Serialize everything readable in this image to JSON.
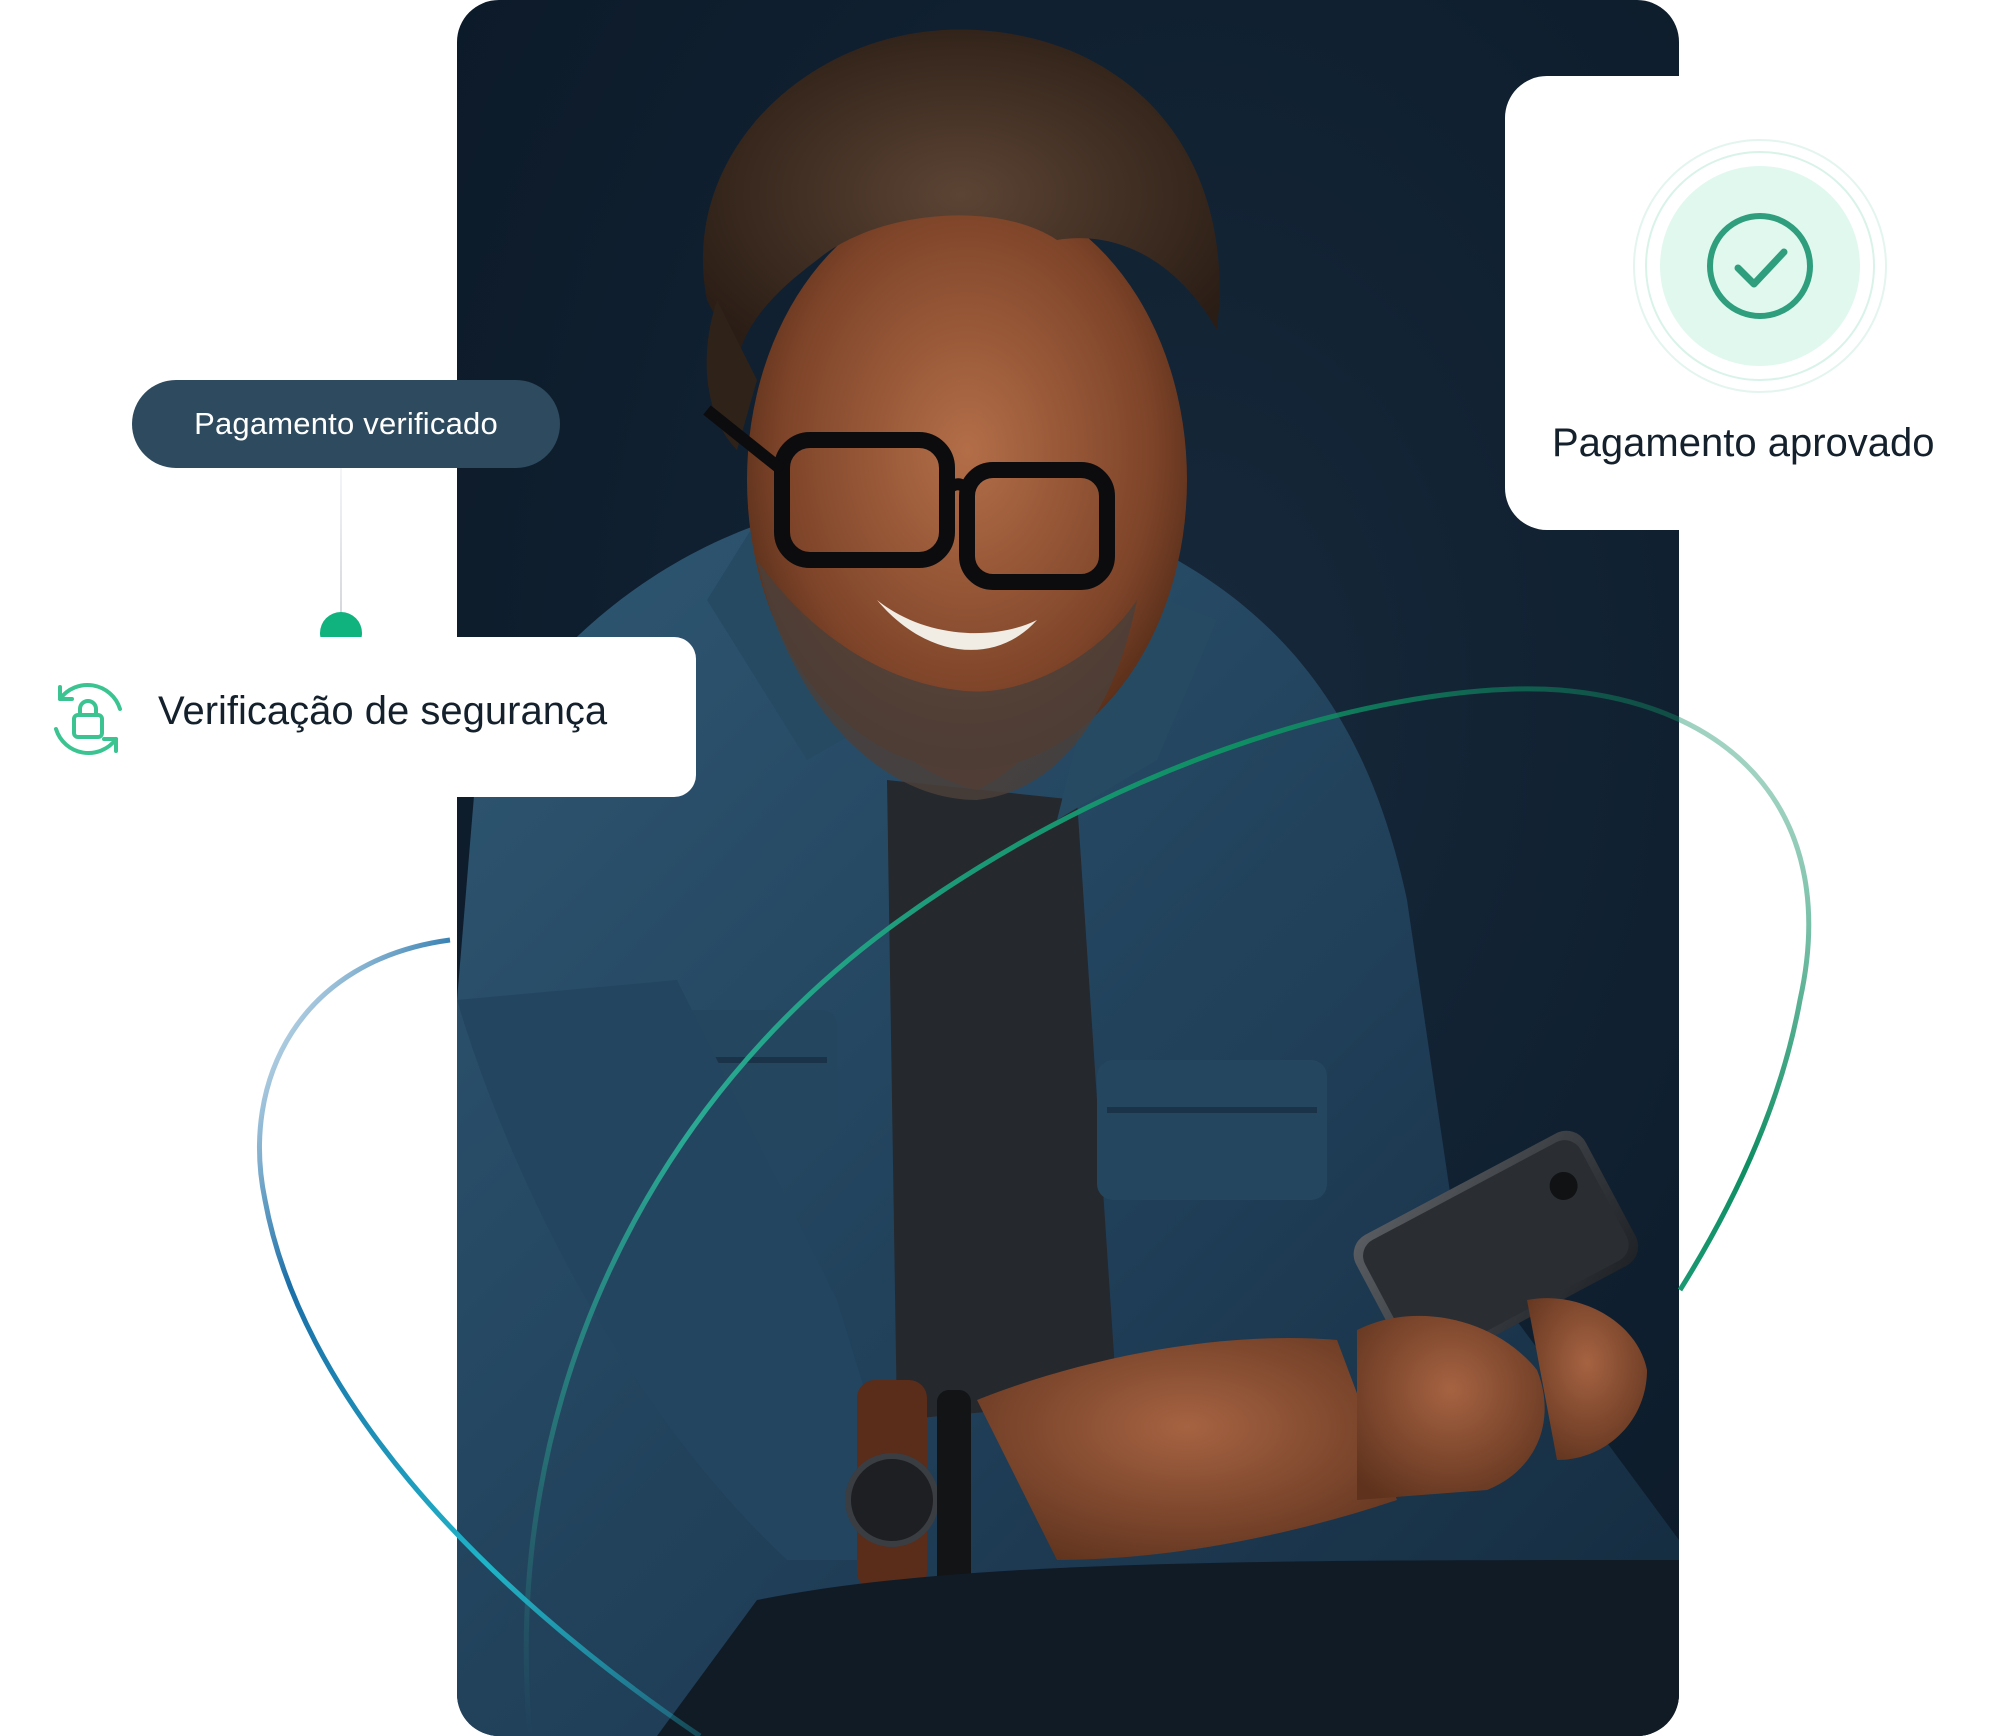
{
  "badges": {
    "verified_chip": "Pagamento verificado",
    "security_card": "Verificação de segurança",
    "approved_card": "Pagamento aprovado"
  },
  "icons": {
    "security": "lock-refresh-icon",
    "approved": "check-circle-icon"
  },
  "photo": {
    "subject": "smiling man with glasses using smartphone"
  },
  "colors": {
    "panel_bg": "#0f1f2f",
    "chip_bg": "#2e4a5e",
    "accent_green": "#10b27d",
    "curve_teal": "#1aa88a",
    "curve_blue": "#1b6fa8"
  }
}
